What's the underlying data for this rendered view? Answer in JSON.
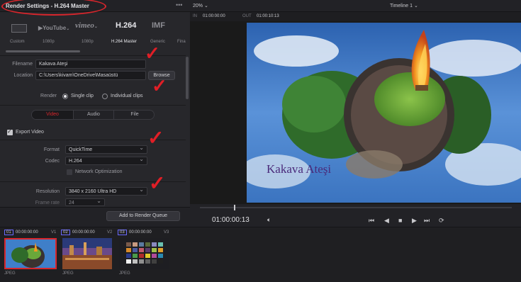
{
  "left_panel": {
    "title": "Render Settings - H.264 Master",
    "menu_dots": "•••",
    "presets": [
      {
        "name": "YouTube",
        "label": "1080p"
      },
      {
        "name": "vimeo",
        "label": "1080p"
      },
      {
        "name": "H.264",
        "label": "H.264 Master"
      },
      {
        "name": "IMF",
        "label": "Generic"
      }
    ],
    "preset_first_label": "Custom",
    "preset_last_label": "Fina",
    "filename": {
      "label": "Filename",
      "value": "Kakava Ateşi"
    },
    "location": {
      "label": "Location",
      "value": "C:\\Users\\kivam\\OneDrive\\Masaüstü",
      "browse": "Browse"
    },
    "render": {
      "label": "Render",
      "single": "Single clip",
      "individual": "Individual clips"
    },
    "tabs": [
      "Video",
      "Audio",
      "File"
    ],
    "export_video": "Export Video",
    "format": {
      "label": "Format",
      "value": "QuickTime"
    },
    "codec": {
      "label": "Codec",
      "value": "H.264"
    },
    "network_opt": "Network Optimization",
    "resolution": {
      "label": "Resolution",
      "value": "3840 x 2160 Ultra HD"
    },
    "frame_rate": {
      "label": "Frame rate",
      "value": "24"
    },
    "add_queue": "Add to Render Queue"
  },
  "viewer": {
    "zoom": "20%",
    "timeline": "Timeline 1",
    "in_label": "IN",
    "in_tc": "01:00:00:00",
    "out_label": "OUT",
    "out_tc": "01:00:10:13",
    "overlay_text": "Kakava Ateşi",
    "current_tc": "01:00:00:13",
    "transport_icons": [
      "skip-back-icon",
      "step-back-icon",
      "stop-icon",
      "play-icon",
      "skip-forward-icon",
      "loop-icon"
    ]
  },
  "clips": [
    {
      "num": "01",
      "tc": "00:00:00:00",
      "track": "V1",
      "format": "JPEG"
    },
    {
      "num": "02",
      "tc": "00:00:00:00",
      "track": "V2",
      "format": "JPEG"
    },
    {
      "num": "03",
      "tc": "00:00:00:00",
      "track": "V3",
      "format": "JPEG"
    }
  ],
  "colors": {
    "accent_red": "#d8262c",
    "panel_bg": "#27272b",
    "sky": "#3f7fc9"
  }
}
